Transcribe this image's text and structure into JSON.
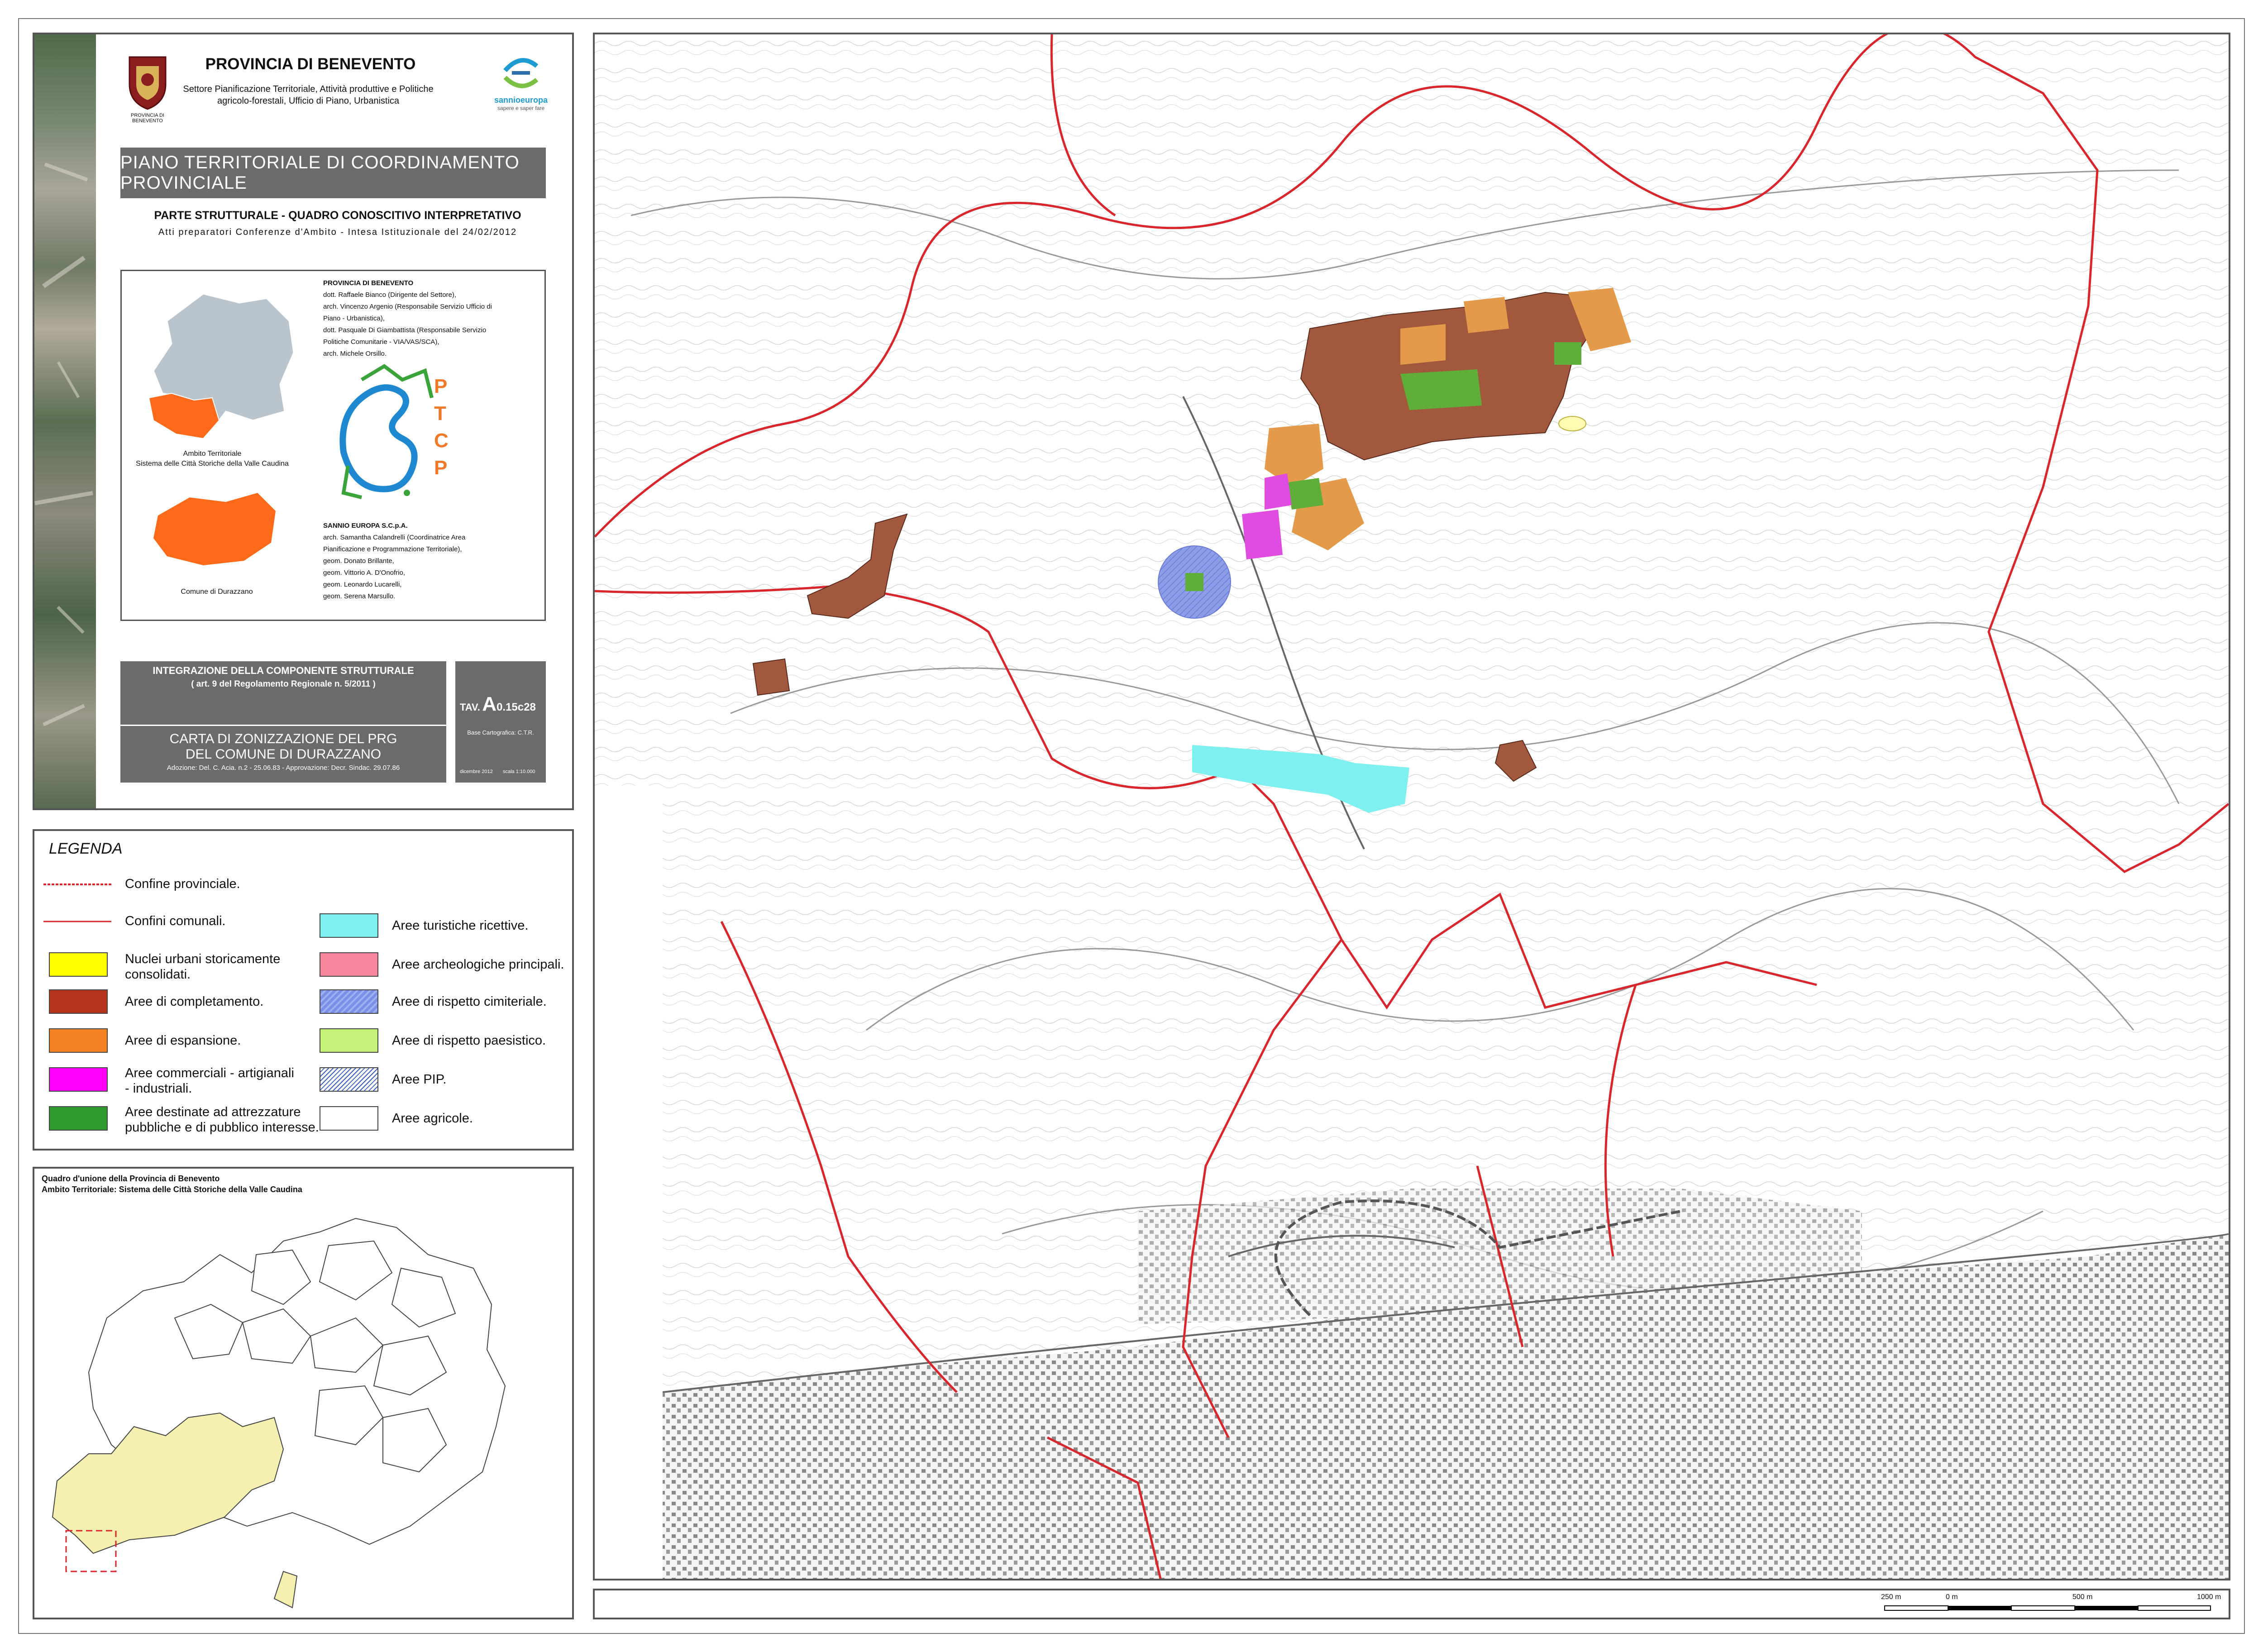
{
  "header": {
    "org": "PROVINCIA DI BENEVENTO",
    "sector_line1": "Settore Pianificazione Territoriale, Attività produttive e Politiche",
    "sector_line2": "agricolo-forestali, Ufficio di Piano, Urbanistica",
    "crest_caption": "PROVINCIA DI BENEVENTO",
    "sannio_brand": "sannioeuropa",
    "sannio_tagline": "sapere e saper fare",
    "plan_title": "PIANO TERRITORIALE DI COORDINAMENTO PROVINCIALE",
    "section_title": "PARTE STRUTTURALE - QUADRO CONOSCITIVO INTERPRETATIVO",
    "section_subtitle": "Atti preparatori Conferenze d'Ambito - Intesa Istituzionale del 24/02/2012"
  },
  "inset": {
    "ambito_caption_1": "Ambito Territoriale",
    "ambito_caption_2": "Sistema delle Città Storiche della Valle Caudina",
    "comune_caption": "Comune di Durazzano",
    "ptcp_letters": [
      "P",
      "T",
      "C",
      "P"
    ],
    "credits_provincia": [
      "PROVINCIA DI BENEVENTO",
      "dott. Raffaele Bianco (Dirigente del Settore),",
      "arch. Vincenzo Argenio (Responsabile Servizio Ufficio di",
      "Piano - Urbanistica),",
      "dott. Pasquale Di Giambattista (Responsabile Servizio",
      "Politiche Comunitarie - VIA/VAS/SCA),",
      "arch. Michele Orsillo."
    ],
    "credits_sannio": [
      "SANNIO EUROPA S.C.p.A.",
      "arch. Samantha Calandrelli (Coordinatrice Area",
      "Pianificazione e Programmazione Territoriale),",
      "geom. Donato Brillante,",
      "geom. Vittorio A. D'Onofrio,",
      "geom. Leonardo Lucarelli,",
      "geom. Serena Marsullo."
    ]
  },
  "integration": {
    "title": "INTEGRAZIONE DELLA COMPONENTE STRUTTURALE",
    "subtitle": "( art. 9 del Regolamento Regionale n. 5/2011 )"
  },
  "carta": {
    "title_line1": "CARTA DI ZONIZZAZIONE DEL PRG",
    "title_line2": "DEL COMUNE DI DURAZZANO",
    "adoption": "Adozione: Del. C. Acia. n.2 - 25.06.83 - Approvazione: Decr. Sindac. 29.07.86"
  },
  "tav": {
    "prefix": "TAV.",
    "code_big": "A",
    "code_small": "0.15c28",
    "base": "Base Cartografica: C.T.R.",
    "date": "dicembre 2012",
    "scale": "scala 1:10.000"
  },
  "legend": {
    "title": "LEGENDA",
    "line_items": [
      {
        "label": "Confine provinciale.",
        "style": "dashed",
        "color": "#d8262c"
      },
      {
        "label": "Confini comunali.",
        "style": "solid",
        "color": "#d8262c"
      }
    ],
    "left_items": [
      {
        "label_1": "Nuclei urbani storicamente",
        "label_2": "consolidati.",
        "color": "#ffff00"
      },
      {
        "label_1": "Aree di completamento.",
        "label_2": "",
        "color": "#b5341c"
      },
      {
        "label_1": "Aree di espansione.",
        "label_2": "",
        "color": "#f58220"
      },
      {
        "label_1": "Aree commerciali - artigianali",
        "label_2": "- industriali.",
        "color": "#ff00ff"
      },
      {
        "label_1": "Aree destinate ad attrezzature",
        "label_2": "pubbliche e di pubblico interesse.",
        "color": "#2e9a2e"
      }
    ],
    "right_items": [
      {
        "label": "Aree turistiche ricettive.",
        "color": "#7ff0f0",
        "hatch": false
      },
      {
        "label": "Aree archeologiche principali.",
        "color": "#f7869c",
        "hatch": false
      },
      {
        "label": "Aree di rispetto cimiteriale.",
        "color": "#7b8fe6",
        "hatch": true
      },
      {
        "label": "Aree di rispetto paesistico.",
        "color": "#c6f27a",
        "hatch": false
      },
      {
        "label": "Aree PIP.",
        "color": "#ffffff",
        "hatch": true
      },
      {
        "label": "Aree agricole.",
        "color": "#ffffff",
        "hatch": false
      }
    ]
  },
  "overview": {
    "title_1": "Quadro d'unione della Provincia di Benevento",
    "title_2": "Ambito Territoriale: Sistema delle Città Storiche della Valle Caudina",
    "fill_color": "#f5f0b0"
  },
  "scale_bar": {
    "labels": [
      "250 m",
      "0 m",
      "500 m",
      "1000 m"
    ]
  },
  "colors": {
    "completamento": "#a1583c",
    "espansione": "#e39a4a",
    "commerciali": "#e04be0",
    "attrezzature": "#5fae3a",
    "turistiche": "#7ff0f0",
    "cimiteriale": "#8e9de8",
    "confine": "#d8262c",
    "ambito": "#ff6a1a",
    "provincia": "#b9c4cc"
  }
}
